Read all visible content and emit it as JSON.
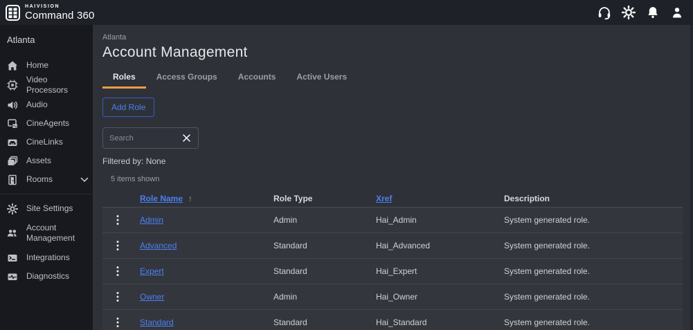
{
  "colors": {
    "accent_orange": "#f09d3f",
    "link_blue": "#4c80f1",
    "topbar_bg": "#1e2127",
    "sidebar_bg": "#17191e",
    "main_bg": "#2e3138",
    "row_bg": "#33363d"
  },
  "topbar": {
    "brand": "HAIVISION",
    "product": "Command 360",
    "icons": [
      {
        "name": "support-headset-icon"
      },
      {
        "name": "settings-gear-icon"
      },
      {
        "name": "notifications-bell-icon"
      },
      {
        "name": "account-person-icon"
      }
    ]
  },
  "sidebar": {
    "location": "Atlanta",
    "items": [
      {
        "label": "Home",
        "icon": "home-icon"
      },
      {
        "label": "Video Processors",
        "icon": "processor-chip-icon"
      },
      {
        "label": "Audio",
        "icon": "speaker-icon"
      },
      {
        "label": "CineAgents",
        "icon": "cineagents-windows-icon"
      },
      {
        "label": "CineLinks",
        "icon": "cinelinks-port-icon"
      },
      {
        "label": "Assets",
        "icon": "assets-layers-icon"
      },
      {
        "label": "Rooms",
        "icon": "door-icon",
        "expandable": true
      },
      {
        "label": "Site Settings",
        "icon": "gear-icon"
      },
      {
        "label": "Account Management",
        "icon": "users-icon"
      },
      {
        "label": "Integrations",
        "icon": "terminal-icon"
      },
      {
        "label": "Diagnostics",
        "icon": "diagnostics-pulse-icon"
      }
    ]
  },
  "main": {
    "location": "Atlanta",
    "title": "Account Management",
    "tabs": [
      {
        "label": "Roles",
        "active": true
      },
      {
        "label": "Access Groups",
        "active": false
      },
      {
        "label": "Accounts",
        "active": false
      },
      {
        "label": "Active Users",
        "active": false
      }
    ],
    "add_button": "Add Role",
    "search": {
      "placeholder": "Search",
      "value": ""
    },
    "filter_status": "Filtered by: None",
    "items_count": "5 items shown",
    "table": {
      "headers": {
        "role_name": "Role Name",
        "role_type": "Role Type",
        "xref": "Xref",
        "description": "Description"
      },
      "sort": {
        "column": "Role Name",
        "direction": "ascending",
        "arrow": "↑"
      },
      "rows": [
        {
          "role_name": "Admin",
          "role_type": "Admin",
          "xref": "Hai_Admin",
          "description": "System generated role."
        },
        {
          "role_name": "Advanced",
          "role_type": "Standard",
          "xref": "Hai_Advanced",
          "description": "System generated role."
        },
        {
          "role_name": "Expert",
          "role_type": "Standard",
          "xref": "Hai_Expert",
          "description": "System generated role."
        },
        {
          "role_name": "Owner",
          "role_type": "Admin",
          "xref": "Hai_Owner",
          "description": "System generated role."
        },
        {
          "role_name": "Standard",
          "role_type": "Standard",
          "xref": "Hai_Standard",
          "description": "System generated role."
        }
      ]
    }
  }
}
